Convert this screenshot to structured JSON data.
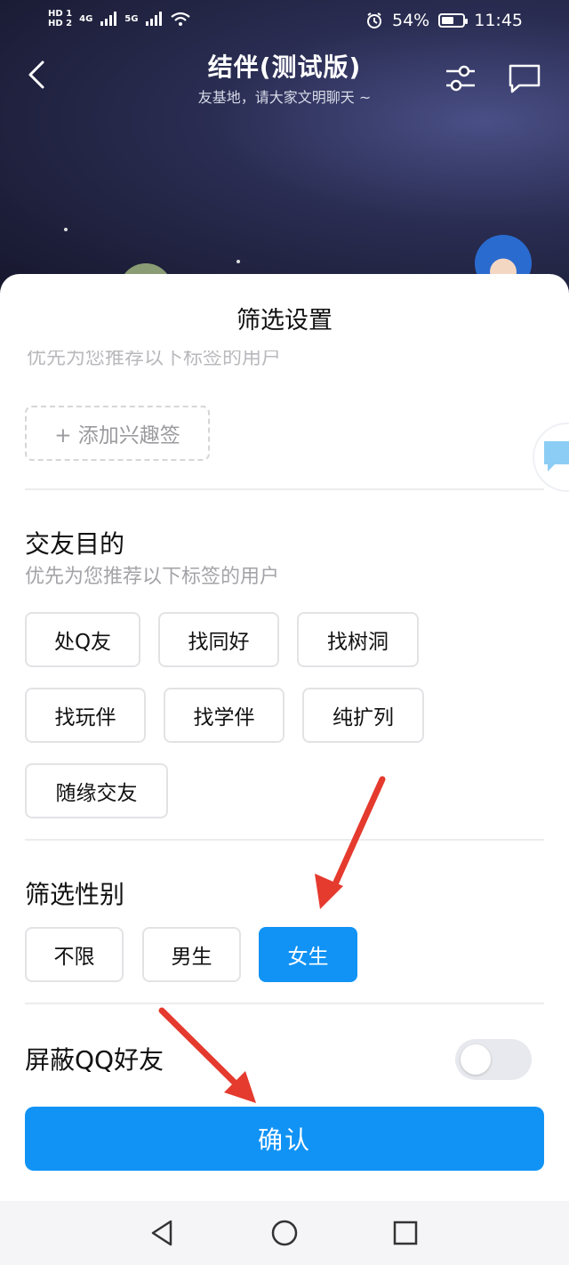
{
  "status_bar": {
    "hd1": "HD 1",
    "hd2": "HD 2",
    "net1": "4G",
    "net2": "5G",
    "battery_pct": "54%",
    "time": "11:45"
  },
  "header": {
    "title": "结伴(测试版)",
    "subtitle": "友基地，请大家文明聊天 ~"
  },
  "sheet": {
    "title": "筛选设置",
    "interest_hint": "优先为您推荐以下标签的用户",
    "add_interest_label": "+ 添加兴趣签",
    "purpose": {
      "title": "交友目的",
      "hint": "优先为您推荐以下标签的用户",
      "chips": [
        "处Q友",
        "找同好",
        "找树洞",
        "找玩伴",
        "找学伴",
        "纯扩列",
        "随缘交友"
      ]
    },
    "gender": {
      "title": "筛选性别",
      "options": [
        "不限",
        "男生",
        "女生"
      ],
      "selected": "女生"
    },
    "block_qq": {
      "label": "屏蔽QQ好友",
      "enabled": false
    },
    "confirm_label": "确认"
  },
  "colors": {
    "accent": "#1193f5",
    "annotation_arrow": "#e53a2e"
  }
}
